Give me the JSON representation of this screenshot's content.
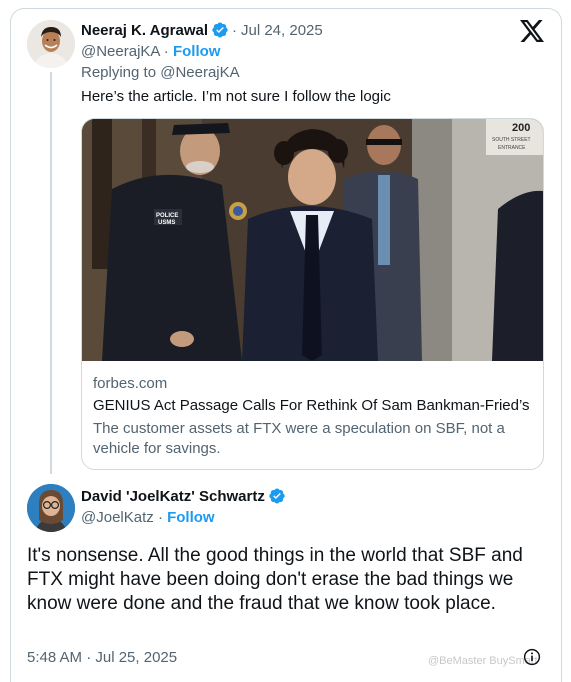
{
  "tweet1": {
    "name": "Neeraj K. Agrawal",
    "date": "Jul 24, 2025",
    "handle": "@NeerajKA",
    "follow": "Follow",
    "replying_prefix": "Replying to ",
    "replying_handle": "@NeerajKA",
    "text": "Here’s the article. I’m not sure I follow the logic",
    "link_card": {
      "domain": "forbes.com",
      "title": "GENIUS Act Passage Calls For Rethink Of Sam Bankman-Fried’s ...",
      "description": "The customer assets at FTX were a speculation on SBF, not a vehicle for savings."
    }
  },
  "tweet2": {
    "name": "David 'JoelKatz' Schwartz",
    "handle": "@JoelKatz",
    "follow": "Follow",
    "text": "It's nonsense. All the good things in the world that SBF and FTX might have been doing don't erase the bad things we know were done and the fraud that we know took place.",
    "timestamp": "5:48 AM · Jul 25, 2025"
  },
  "separator": "·",
  "watermark": "@BeMaster BuySmart",
  "photo_text": {
    "police_badge_line1": "POLICE",
    "police_badge_line2": "USMS",
    "sign_number": "200",
    "sign_line1": "SOUTH STREET",
    "sign_line2": "ENTRANCE"
  },
  "icons": {
    "verified": "verified-badge-icon",
    "x_logo": "x-logo-icon",
    "info": "info-icon"
  },
  "colors": {
    "accent": "#1d9bf0",
    "text": "#0f1419",
    "secondary": "#536471",
    "border": "#cfd9de"
  }
}
